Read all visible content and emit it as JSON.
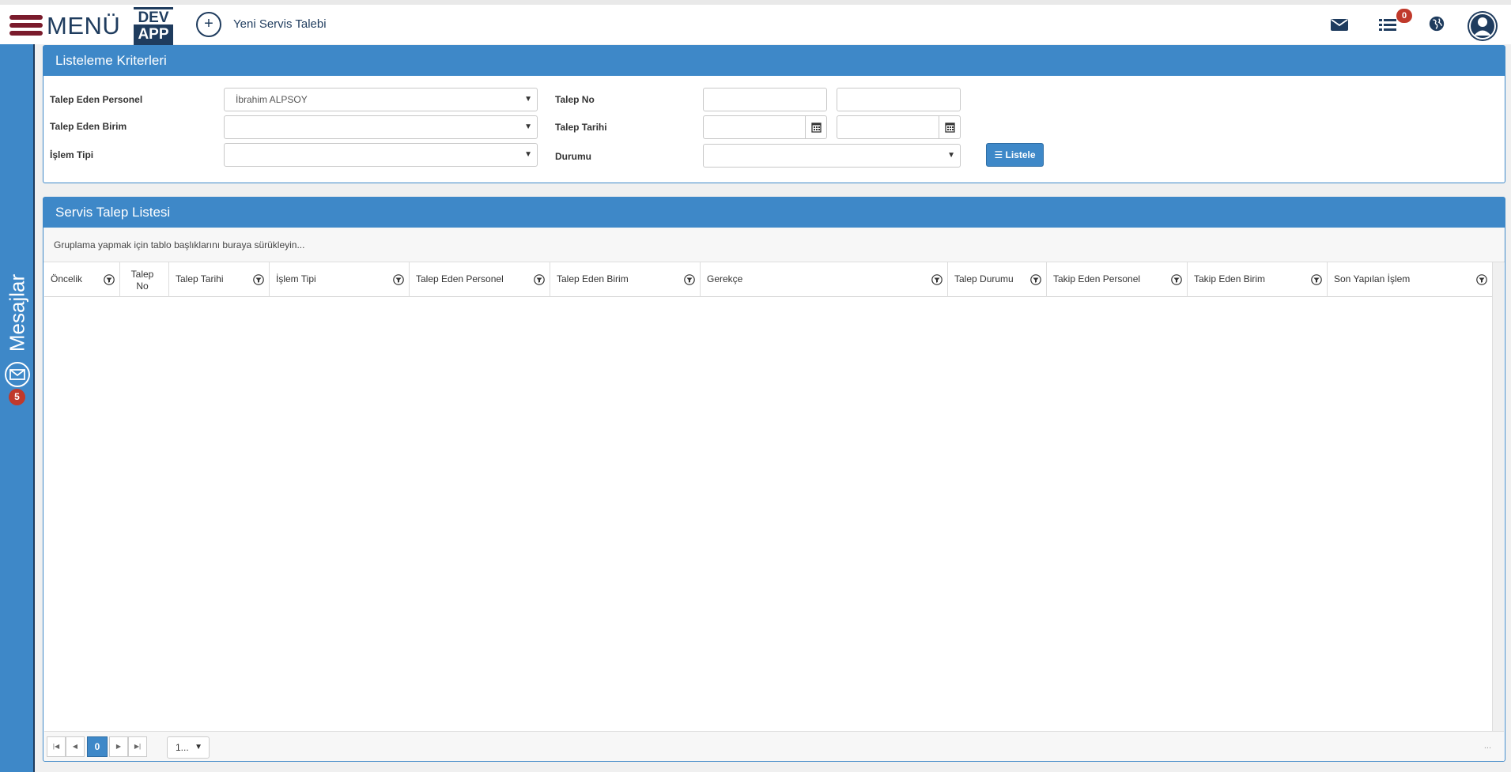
{
  "topbar": {
    "menu_label": "MENÜ",
    "logo_top": "DEV",
    "logo_bottom": "APP",
    "new_request_icon": "+",
    "new_request_label": "Yeni Servis Talebi",
    "mail_icon": "envelope-icon",
    "tasks_icon": "list-icon",
    "tasks_badge": "0",
    "language_icon": "globe-icon",
    "profile_icon": "user-avatar-icon"
  },
  "sidebar": {
    "label": "Mesajlar",
    "icon": "envelope-outline-icon",
    "badge": "5"
  },
  "criteria": {
    "title": "Listeleme Kriterleri",
    "requester_label": "Talep Eden Personel",
    "requester_value": "İbrahim ALPSOY",
    "unit_label": "Talep Eden Birim",
    "unit_value": "",
    "op_type_label": "İşlem Tipi",
    "op_type_value": "",
    "request_no_label": "Talep No",
    "request_no_from": "",
    "request_no_to": "",
    "request_date_label": "Talep Tarihi",
    "request_date_from": "",
    "request_date_to": "",
    "status_label": "Durumu",
    "status_value": "",
    "list_button": "Listele"
  },
  "listing": {
    "title": "Servis Talep Listesi",
    "group_hint": "Gruplama yapmak için tablo başlıklarını buraya sürükleyin...",
    "columns": [
      "Öncelik",
      "Talep No",
      "Talep Tarihi",
      "İşlem Tipi",
      "Talep Eden Personel",
      "Talep Eden Birim",
      "Gerekçe",
      "Talep Durumu",
      "Takip Eden Personel",
      "Takip Eden Birim",
      "Son Yapılan İşlem"
    ],
    "rows": [],
    "pager": {
      "current_page": "0",
      "page_size": "1...",
      "info": "..."
    }
  },
  "colors": {
    "primary": "#3e88c8",
    "navy": "#1f3c5e",
    "hamburger": "#7a1b2c",
    "badge": "#c0392b"
  }
}
